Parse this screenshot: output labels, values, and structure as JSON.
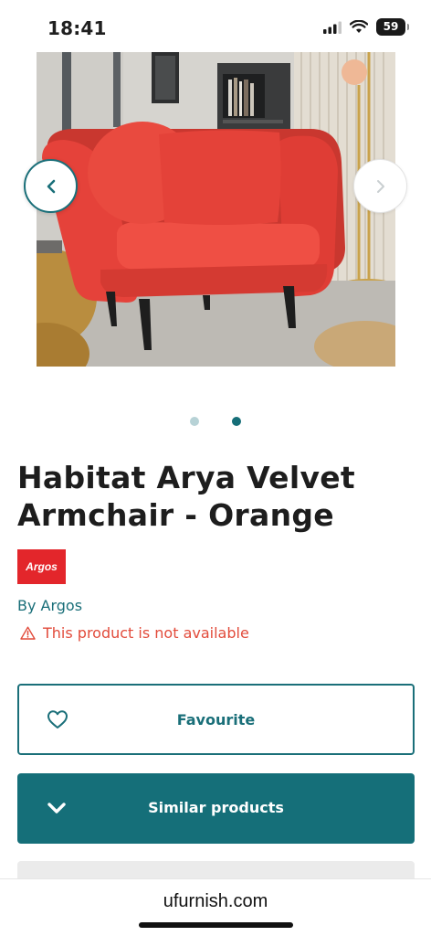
{
  "status_bar": {
    "time": "18:41",
    "battery_level": "59",
    "icons": [
      "signal-icon",
      "wifi-icon",
      "battery-icon"
    ]
  },
  "carousel": {
    "prev_icon": "chevron-left-icon",
    "next_icon": "chevron-right-icon",
    "slide_count": 2,
    "active_index": 1,
    "image_description": "orange velvet armchair"
  },
  "product": {
    "title": "Habitat Arya Velvet Armchair - Orange",
    "brand_logo_text": "Argos",
    "by_line": "By Argos",
    "availability": "This product is not available",
    "availability_icon": "warning-triangle-icon"
  },
  "actions": {
    "favourite_label": "Favourite",
    "favourite_icon": "heart-icon",
    "similar_label": "Similar products",
    "similar_icon": "chevron-down-icon"
  },
  "browser": {
    "url": "ufurnish.com"
  },
  "colors": {
    "brand_teal": "#156f79",
    "warning_red": "#e24b3b",
    "argos_red": "#e3262b",
    "chair_orange": "#e5423a"
  }
}
